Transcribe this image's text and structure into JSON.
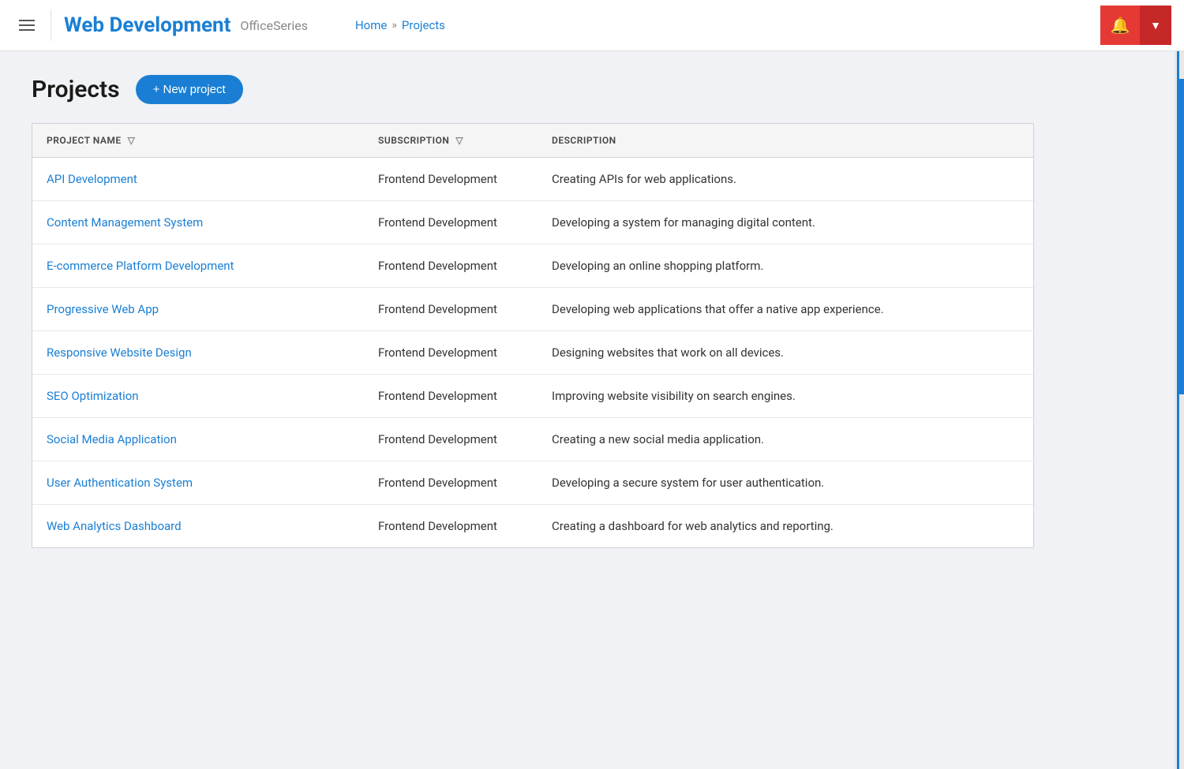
{
  "header": {
    "menu_label": "menu",
    "title": "Web Development",
    "subtitle": "OfficeSeries",
    "nav": {
      "home": "Home",
      "separator": "»",
      "current": "Projects"
    },
    "bell_label": "🔔",
    "dropdown_label": "▼"
  },
  "page": {
    "title": "Projects",
    "new_project_label": "+ New project"
  },
  "table": {
    "columns": {
      "project_name": "PROJECT NAME",
      "subscription": "SUBSCRIPTION",
      "description": "DESCRIPTION"
    },
    "rows": [
      {
        "name": "API Development",
        "subscription": "Frontend Development",
        "description": "Creating APIs for web applications."
      },
      {
        "name": "Content Management System",
        "subscription": "Frontend Development",
        "description": "Developing a system for managing digital content."
      },
      {
        "name": "E-commerce Platform Development",
        "subscription": "Frontend Development",
        "description": "Developing an online shopping platform."
      },
      {
        "name": "Progressive Web App",
        "subscription": "Frontend Development",
        "description": "Developing web applications that offer a native app experience."
      },
      {
        "name": "Responsive Website Design",
        "subscription": "Frontend Development",
        "description": "Designing websites that work on all devices."
      },
      {
        "name": "SEO Optimization",
        "subscription": "Frontend Development",
        "description": "Improving website visibility on search engines."
      },
      {
        "name": "Social Media Application",
        "subscription": "Frontend Development",
        "description": "Creating a new social media application."
      },
      {
        "name": "User Authentication System",
        "subscription": "Frontend Development",
        "description": "Developing a secure system for user authentication."
      },
      {
        "name": "Web Analytics Dashboard",
        "subscription": "Frontend Development",
        "description": "Creating a dashboard for web analytics and reporting."
      }
    ]
  }
}
